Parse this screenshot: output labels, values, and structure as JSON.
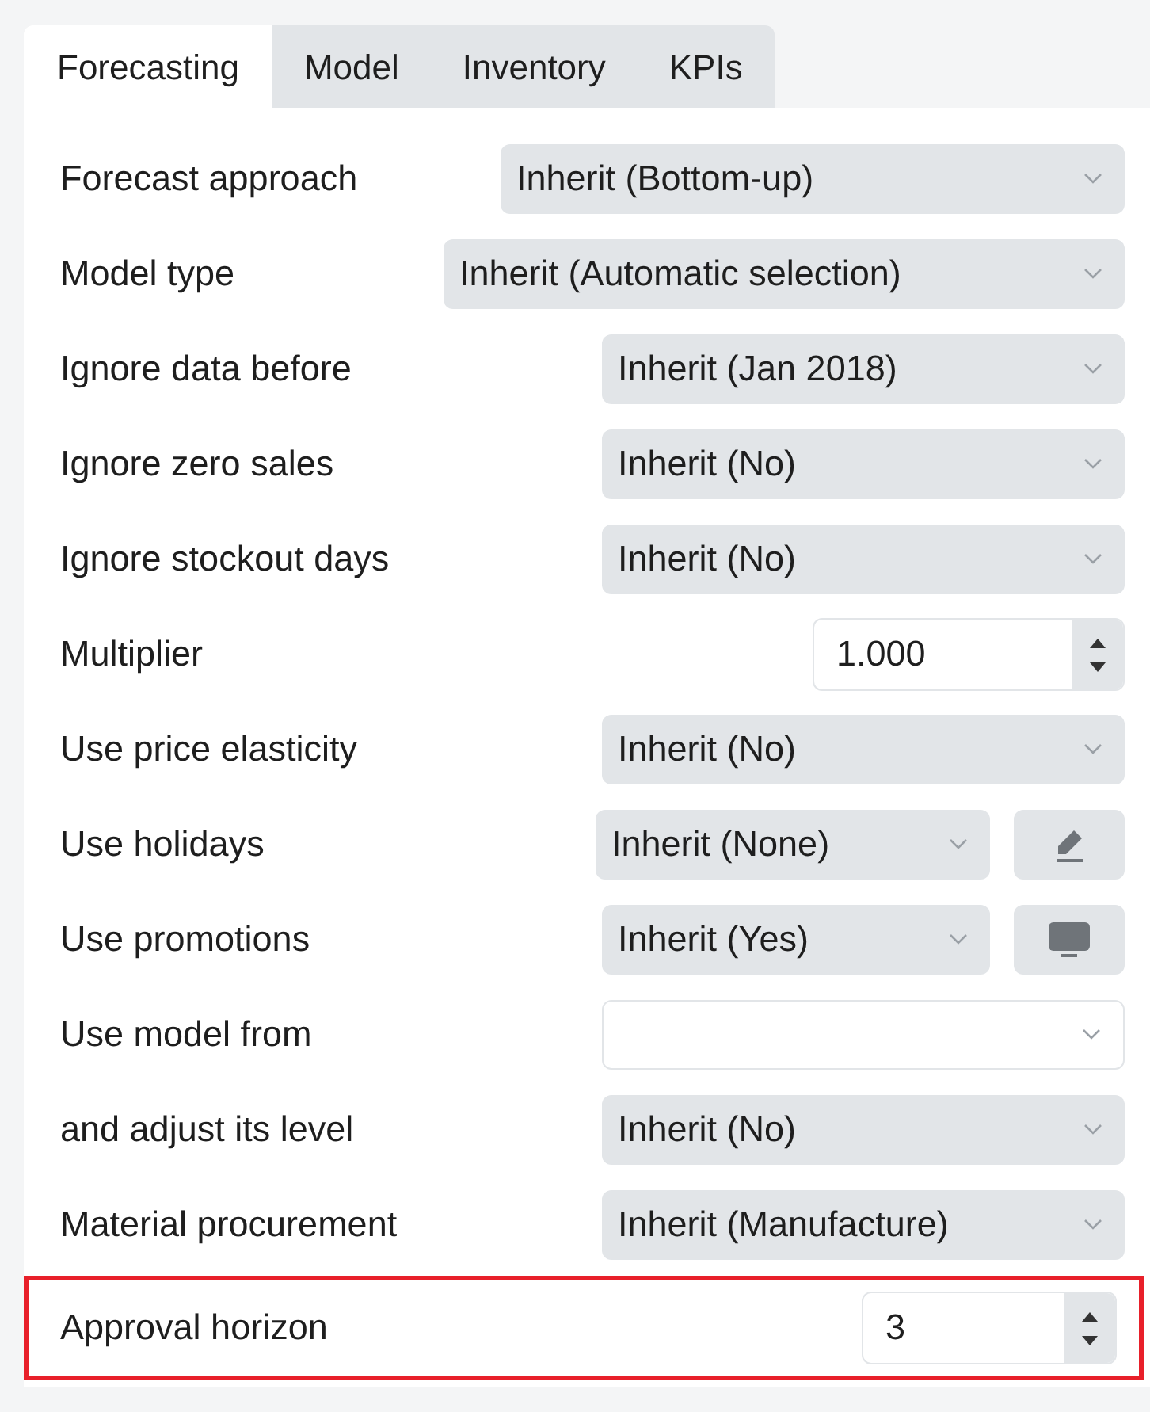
{
  "tabs": [
    {
      "label": "Forecasting",
      "selected": true
    },
    {
      "label": "Model",
      "selected": false
    },
    {
      "label": "Inventory",
      "selected": false
    },
    {
      "label": "KPIs",
      "selected": false
    }
  ],
  "rows": [
    {
      "label": "Forecast approach",
      "kind": "select",
      "value": "Inherit (Bottom-up)",
      "highlighted": false
    },
    {
      "label": "Model type",
      "kind": "select",
      "value": "Inherit (Automatic selection)",
      "highlighted": false
    },
    {
      "label": "Ignore data before",
      "kind": "select",
      "value": "Inherit (Jan 2018)",
      "highlighted": false
    },
    {
      "label": "Ignore zero sales",
      "kind": "select",
      "value": "Inherit (No)",
      "highlighted": false
    },
    {
      "label": "Ignore stockout days",
      "kind": "select",
      "value": "Inherit (No)",
      "highlighted": false
    },
    {
      "label": "Multiplier",
      "kind": "spinner",
      "value": "1.000",
      "highlighted": false
    },
    {
      "label": "Use price elasticity",
      "kind": "select",
      "value": "Inherit (No)",
      "highlighted": false
    },
    {
      "label": "Use holidays",
      "kind": "select_button",
      "value": "Inherit (None)",
      "highlighted": false
    },
    {
      "label": "Use promotions",
      "kind": "select_button",
      "value": "Inherit (Yes)",
      "highlighted": false
    },
    {
      "label": "Use model from",
      "kind": "combo",
      "highlighted": false
    },
    {
      "label": "and adjust its level",
      "kind": "select",
      "value": "Inherit (No)",
      "highlighted": false
    },
    {
      "label": "Material procurement",
      "kind": "select",
      "value": "Inherit (Manufacture)",
      "highlighted": false
    },
    {
      "label": "Approval horizon",
      "kind": "spinner",
      "value": "3",
      "highlighted": true
    }
  ]
}
